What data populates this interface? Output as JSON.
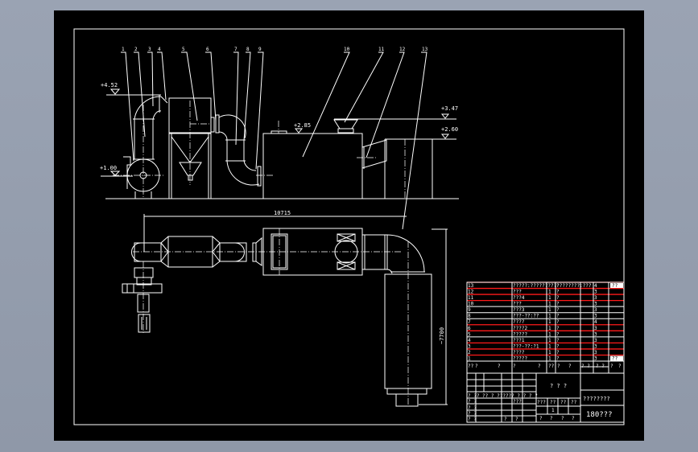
{
  "drawing": {
    "item_labels": [
      "1",
      "2",
      "3",
      "4",
      "5",
      "6",
      "7",
      "8",
      "9",
      "10",
      "11",
      "12",
      "13"
    ],
    "elevations": [
      "+4.52",
      "+1.00",
      "+2.85",
      "+3.47",
      "+2.60"
    ],
    "dim_length": "10715",
    "dim_width": "~7700"
  },
  "parts_list": {
    "rows": [
      {
        "no": "13",
        "name": "?????:?????????????????:???",
        "qty": "",
        "mat": "?",
        "note": "4",
        "badge": "??"
      },
      {
        "no": "12",
        "name": "???",
        "qty": "1",
        "mat": "?",
        "note": "3"
      },
      {
        "no": "11",
        "name": "???4",
        "qty": "1",
        "mat": "?",
        "note": "3"
      },
      {
        "no": "10",
        "name": "???",
        "qty": "1",
        "mat": "?",
        "note": "3"
      },
      {
        "no": "9",
        "name": "???3",
        "qty": "1",
        "mat": "?",
        "note": "3"
      },
      {
        "no": "8",
        "name": "???-??:??",
        "qty": "1",
        "mat": "?",
        "note": "3"
      },
      {
        "no": "7",
        "name": "????",
        "qty": "1",
        "mat": "?",
        "note": "4"
      },
      {
        "no": "6",
        "name": "????2",
        "qty": "1",
        "mat": "?",
        "note": "3"
      },
      {
        "no": "5",
        "name": "?????",
        "qty": "1",
        "mat": "?",
        "note": "3"
      },
      {
        "no": "4",
        "name": "???1",
        "qty": "1",
        "mat": "?",
        "note": "3"
      },
      {
        "no": "3",
        "name": "???-??:?1",
        "qty": "1",
        "mat": "?",
        "note": "3"
      },
      {
        "no": "2",
        "name": "????",
        "qty": "1",
        "mat": "?",
        "note": "3"
      },
      {
        "no": "1",
        "name": "?????",
        "qty": "1",
        "mat": "?",
        "note": "3",
        "badge": "??"
      }
    ],
    "header": [
      "??",
      "?",
      "?",
      "?",
      "?",
      "??",
      "?",
      "?",
      "? ?",
      "? ?",
      "?",
      "?"
    ]
  },
  "title_block": {
    "drawing_name": "? ? ?",
    "company": "????????",
    "drawing_no": "180???",
    "scale_row": [
      "???",
      "??",
      "??",
      "??"
    ],
    "sheet": "1",
    "sign_row": [
      "?",
      "?",
      "?",
      "?"
    ],
    "left_labels": [
      "? ?? ?? ?  ?????? ? ? ? ?",
      "? ?",
      "???",
      "? ?",
      "? ?",
      "? ?",
      "?",
      "?"
    ]
  },
  "colors": {
    "paper": "#000000",
    "line": "#ffffff",
    "highlight": "#ff1a1a",
    "background": "#959eae"
  }
}
